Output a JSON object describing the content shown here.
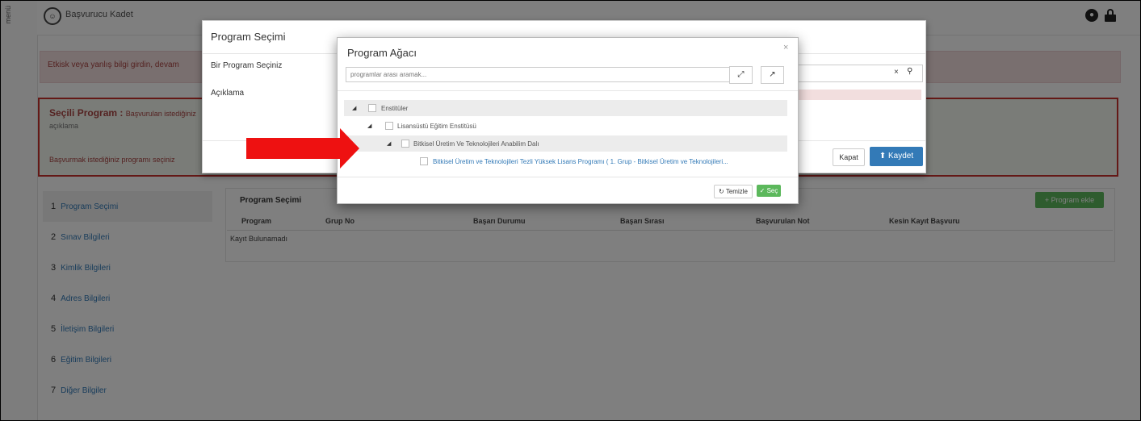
{
  "app": {
    "menu_label": "menü",
    "brand_text": "Başvurucu Kadet",
    "brand_icon": "user-circle-icon"
  },
  "alert": {
    "text": "Etkisk veya yanlış bilgi girdin, devam"
  },
  "selected_program": {
    "title": "Seçili Program :",
    "title_value": "Başvurulan istediğiniz",
    "desc_label": "açıklama",
    "link_text": "Başvurmak istediğiniz programı seçiniz"
  },
  "steps": [
    {
      "num": "1",
      "label": "Program Seçimi"
    },
    {
      "num": "2",
      "label": "Sınav Bilgileri"
    },
    {
      "num": "3",
      "label": "Kimlik Bilgileri"
    },
    {
      "num": "4",
      "label": "Adres Bilgileri"
    },
    {
      "num": "5",
      "label": "İletişim Bilgileri"
    },
    {
      "num": "6",
      "label": "Eğitim Bilgileri"
    },
    {
      "num": "7",
      "label": "Diğer Bilgiler"
    }
  ],
  "content": {
    "title": "Program Seçimi",
    "add_button": "+ Program ekle",
    "columns": [
      "Program",
      "Grup No",
      "Başarı Durumu",
      "Başarı Sırası",
      "Başvurulan Not",
      "Kesin Kayıt Başvuru"
    ],
    "empty_text": "Kayıt Bulunamadı"
  },
  "modal_program": {
    "title": "Program Seçimi",
    "label_program": "Bir Program Seçiniz",
    "label_desc": "Açıklama",
    "clear": "×",
    "close_button": "Kapat",
    "save_button": "Kaydet",
    "save_icon": "upload-icon"
  },
  "modal_tree": {
    "title": "Program Ağacı",
    "search_placeholder": "programlar arası aramak...",
    "close": "×",
    "expand_icon": "⤢",
    "collapse_icon": "↗",
    "nodes": [
      {
        "label": "Enstitüler"
      },
      {
        "label": "Lisansüstü Eğitim Enstitüsü"
      },
      {
        "label": "Bitkisel Üretim Ve Teknolojileri Anabilim Dalı"
      },
      {
        "label": "Bitkisel Üretim ve Teknolojileri Tezli Yüksek Lisans Programı ( 1. Grup - Bitkisel Üretim ve Teknolojileri..."
      }
    ],
    "reset_button": "Temizle",
    "reset_icon": "↻",
    "select_button": "Seç",
    "select_icon": "✓"
  },
  "colors": {
    "primary": "#337ab7",
    "success": "#5cb85c",
    "danger": "#c9302c",
    "arrow": "#ee1111"
  }
}
